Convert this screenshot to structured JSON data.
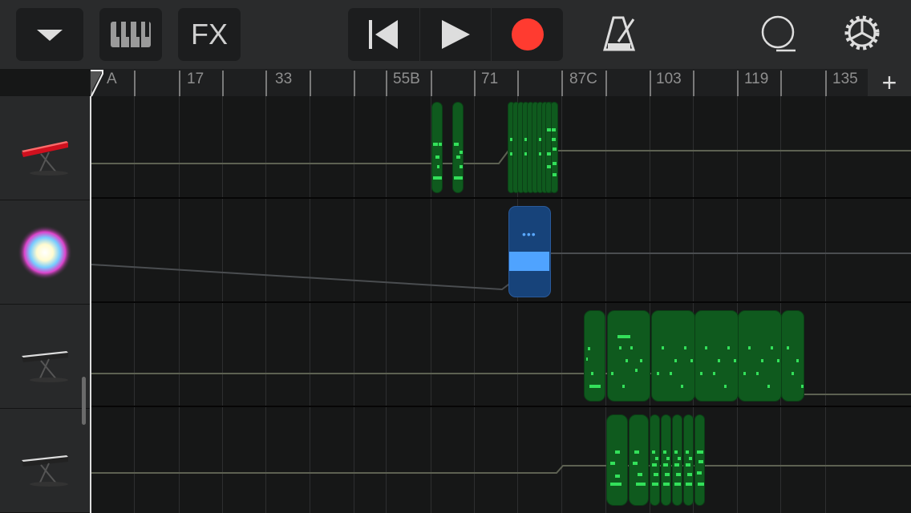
{
  "toolbar": {
    "browser_icon": "triangle-down-icon",
    "instrument_icon": "piano-keys-icon",
    "fx_label": "FX",
    "transport": {
      "rewind_icon": "go-to-start-icon",
      "play_icon": "play-icon",
      "record_icon": "record-icon"
    },
    "metronome_icon": "metronome-icon",
    "loop_icon": "loop-browser-icon",
    "settings_icon": "gear-icon"
  },
  "ruler": {
    "labels": [
      "A",
      "17",
      "33",
      "55B",
      "71",
      "87C",
      "103",
      "119",
      "135"
    ],
    "add_icon": "+"
  },
  "tracks": [
    {
      "instrument": "Red synth keyboard",
      "region_color": "#0f5a1e"
    },
    {
      "instrument": "Sampler burst",
      "region_color": "#17437a"
    },
    {
      "instrument": "Keyboard",
      "region_color": "#0f5a1e"
    },
    {
      "instrument": "Keyboard",
      "region_color": "#0f5a1e"
    }
  ],
  "colors": {
    "accent_record": "#ff3b30",
    "midi_region": "#0f5a1e",
    "midi_note": "#33e05a",
    "audio_region": "#17437a",
    "audio_wave": "#4fa3ff"
  }
}
